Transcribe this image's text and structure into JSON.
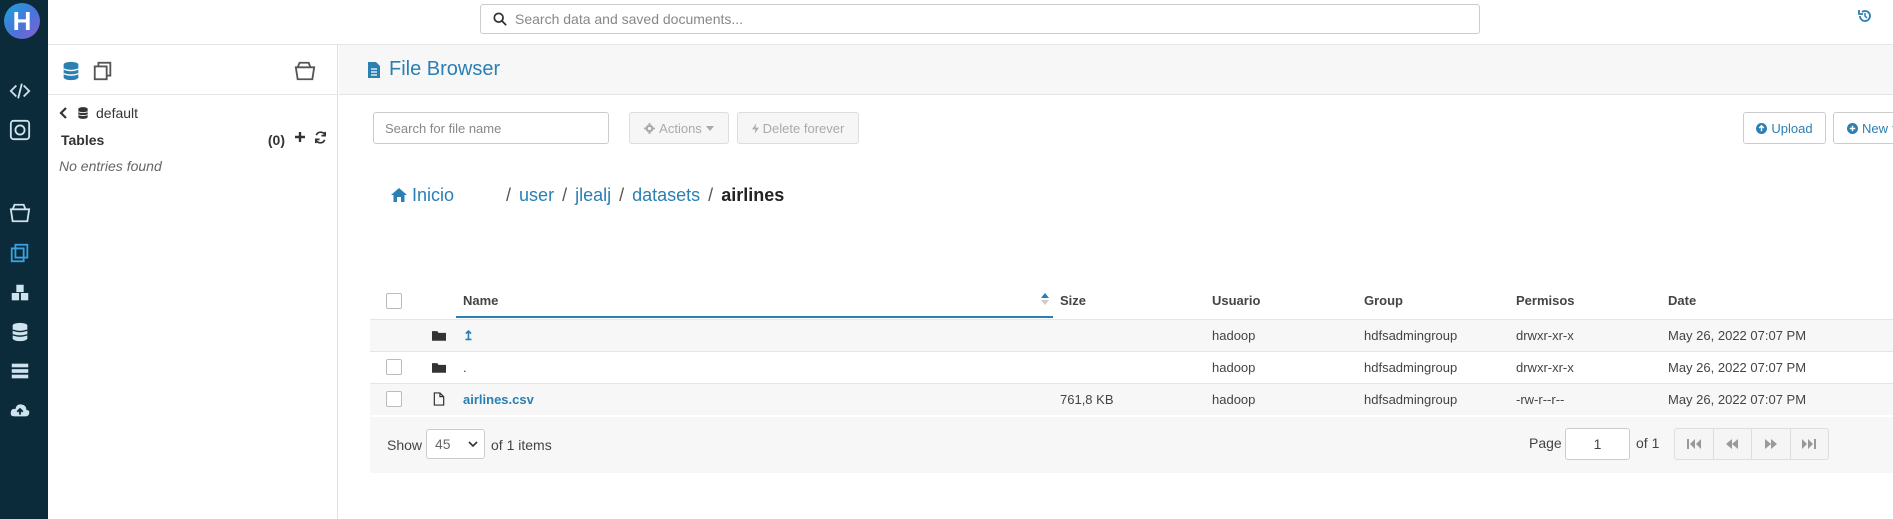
{
  "header": {
    "search_placeholder": "Search data and saved documents..."
  },
  "assist": {
    "database": "default",
    "tables_label": "Tables",
    "tables_count": "(0)",
    "empty_message": "No entries found"
  },
  "page": {
    "title": "File Browser"
  },
  "toolbar": {
    "file_search_placeholder": "Search for file name",
    "actions_label": "Actions",
    "delete_label": "Delete forever",
    "upload_label": "Upload",
    "new_label": "New"
  },
  "breadcrumb": {
    "home": "Inicio",
    "parts": [
      "user",
      "jlealj",
      "datasets"
    ],
    "current": "airlines"
  },
  "table": {
    "columns": [
      "Name",
      "Size",
      "Usuario",
      "Group",
      "Permisos",
      "Date"
    ],
    "rows": [
      {
        "name": "↥",
        "size": "",
        "user": "hadoop",
        "group": "hdfsadmingroup",
        "perms": "drwxr-xr-x",
        "date": "May 26, 2022 07:07 PM"
      },
      {
        "name": ".",
        "size": "",
        "user": "hadoop",
        "group": "hdfsadmingroup",
        "perms": "drwxr-xr-x",
        "date": "May 26, 2022 07:07 PM"
      },
      {
        "name": "airlines.csv",
        "size": "761,8 KB",
        "user": "hadoop",
        "group": "hdfsadmingroup",
        "perms": "-rw-r--r--",
        "date": "May 26, 2022 07:07 PM"
      }
    ]
  },
  "footer": {
    "show_label": "Show",
    "page_size": "45",
    "of_items": "of 1 items",
    "page_label": "Page",
    "page_value": "1",
    "of_pages": "of 1"
  },
  "colors": {
    "accent": "#2a7fb3",
    "nav_bg": "#0b2a3a"
  }
}
